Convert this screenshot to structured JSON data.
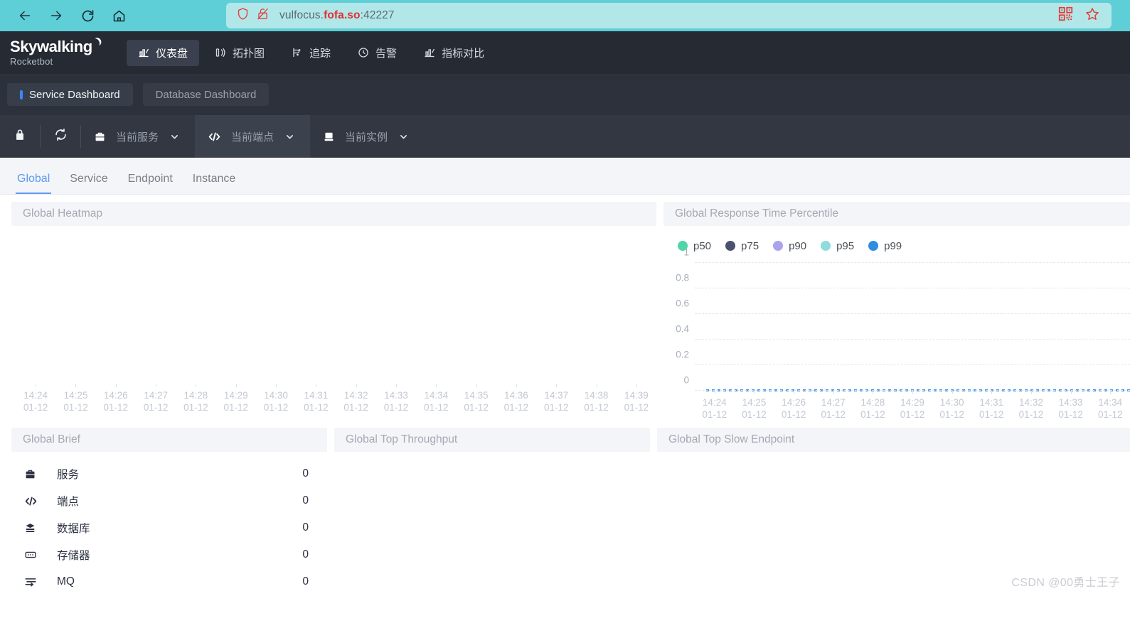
{
  "browser": {
    "back_icon": "back-arrow-icon",
    "forward_icon": "forward-arrow-icon",
    "reload_icon": "reload-icon",
    "home_icon": "home-icon",
    "shield_icon": "shield-icon",
    "insecure_icon": "broken-lock-icon",
    "url_prefix": "vulfocus.",
    "url_domain": "fofa.so",
    "url_suffix": ":42227",
    "qr_icon": "qr-code-icon",
    "bookmark_icon": "star-icon",
    "bar_color": "#5ecfd6",
    "url_field_color": "#b2e7e9"
  },
  "header": {
    "logo_main": "Skywalking",
    "logo_sub": "Rocketbot",
    "nav": [
      {
        "label": "仪表盘",
        "icon": "chart-icon",
        "active": true
      },
      {
        "label": "拓扑图",
        "icon": "topology-icon",
        "active": false
      },
      {
        "label": "追踪",
        "icon": "trace-icon",
        "active": false
      },
      {
        "label": "告警",
        "icon": "alarm-clock-icon",
        "active": false
      },
      {
        "label": "指标对比",
        "icon": "compare-chart-icon",
        "active": false
      }
    ]
  },
  "dashboard_tabs": [
    {
      "label": "Service Dashboard",
      "active": true
    },
    {
      "label": "Database Dashboard",
      "active": false
    }
  ],
  "selector_bar": {
    "lock_icon": "lock-icon",
    "reload_icon": "sync-icon",
    "selectors": [
      {
        "icon": "briefcase-icon",
        "label": "当前服务",
        "caret": "chevron-down-icon",
        "highlighted": false
      },
      {
        "icon": "code-icon",
        "label": "当前端点",
        "caret": "chevron-down-icon",
        "highlighted": true
      },
      {
        "icon": "server-icon",
        "label": "当前实例",
        "caret": "chevron-down-icon",
        "highlighted": false
      }
    ]
  },
  "sub_tabs": [
    {
      "label": "Global",
      "active": true
    },
    {
      "label": "Service",
      "active": false
    },
    {
      "label": "Endpoint",
      "active": false
    },
    {
      "label": "Instance",
      "active": false
    }
  ],
  "panels": {
    "heatmap_title": "Global Heatmap",
    "percentile_title": "Global Response Time Percentile",
    "brief_title": "Global Brief",
    "throughput_title": "Global Top Throughput",
    "slow_endpoint_title": "Global Top Slow Endpoint"
  },
  "brief_items": [
    {
      "icon": "briefcase-icon",
      "label": "服务",
      "value": "0"
    },
    {
      "icon": "code-icon",
      "label": "端点",
      "value": "0"
    },
    {
      "icon": "database-icon",
      "label": "数据库",
      "value": "0"
    },
    {
      "icon": "cache-icon",
      "label": "存储器",
      "value": "0"
    },
    {
      "icon": "mq-icon",
      "label": "MQ",
      "value": "0"
    }
  ],
  "watermark": "CSDN @00勇士王子",
  "chart_data": [
    {
      "type": "heatmap",
      "title": "Global Heatmap",
      "xlabel": "",
      "ylabel": "",
      "grid": false,
      "legend": "none",
      "x": [
        "14:24\n01-12",
        "14:25\n01-12",
        "14:26\n01-12",
        "14:27\n01-12",
        "14:28\n01-12",
        "14:29\n01-12",
        "14:30\n01-12",
        "14:31\n01-12",
        "14:32\n01-12",
        "14:33\n01-12",
        "14:34\n01-12",
        "14:35\n01-12",
        "14:36\n01-12",
        "14:37\n01-12",
        "14:38\n01-12",
        "14:39\n01-12"
      ],
      "xtick_times": [
        "14:24",
        "14:25",
        "14:26",
        "14:27",
        "14:28",
        "14:29",
        "14:30",
        "14:31",
        "14:32",
        "14:33",
        "14:34",
        "14:35",
        "14:36",
        "14:37",
        "14:38",
        "14:39"
      ],
      "xtick_dates": [
        "01-12",
        "01-12",
        "01-12",
        "01-12",
        "01-12",
        "01-12",
        "01-12",
        "01-12",
        "01-12",
        "01-12",
        "01-12",
        "01-12",
        "01-12",
        "01-12",
        "01-12",
        "01-12"
      ],
      "values": [],
      "note": "no data rendered in plot area"
    },
    {
      "type": "line",
      "title": "Global Response Time Percentile",
      "xlabel": "",
      "ylabel": "",
      "ylim": [
        0,
        1
      ],
      "yticks": [
        "0",
        "0.2",
        "0.4",
        "0.6",
        "0.8",
        "1"
      ],
      "grid": true,
      "legend_position": "top-left",
      "xtick_times": [
        "14:24",
        "14:25",
        "14:26",
        "14:27",
        "14:28",
        "14:29",
        "14:30",
        "14:31",
        "14:32",
        "14:33",
        "14:34"
      ],
      "xtick_dates": [
        "01-12",
        "01-12",
        "01-12",
        "01-12",
        "01-12",
        "01-12",
        "01-12",
        "01-12",
        "01-12",
        "01-12",
        "01-12"
      ],
      "series": [
        {
          "name": "p50",
          "color": "#4fd6a8",
          "values": [
            0,
            0,
            0,
            0,
            0,
            0,
            0,
            0,
            0,
            0,
            0
          ]
        },
        {
          "name": "p75",
          "color": "#4a5270",
          "values": [
            0,
            0,
            0,
            0,
            0,
            0,
            0,
            0,
            0,
            0,
            0
          ]
        },
        {
          "name": "p90",
          "color": "#a9a4ed",
          "values": [
            0,
            0,
            0,
            0,
            0,
            0,
            0,
            0,
            0,
            0,
            0
          ]
        },
        {
          "name": "p95",
          "color": "#8fdbdd",
          "values": [
            0,
            0,
            0,
            0,
            0,
            0,
            0,
            0,
            0,
            0,
            0
          ]
        },
        {
          "name": "p99",
          "color": "#2f8ce0",
          "values": [
            0,
            0,
            0,
            0,
            0,
            0,
            0,
            0,
            0,
            0,
            0
          ]
        }
      ]
    },
    {
      "type": "table",
      "title": "Global Brief",
      "columns": [
        "metric",
        "value"
      ],
      "rows": [
        [
          "服务",
          "0"
        ],
        [
          "端点",
          "0"
        ],
        [
          "数据库",
          "0"
        ],
        [
          "存储器",
          "0"
        ],
        [
          "MQ",
          "0"
        ]
      ]
    },
    {
      "type": "bar",
      "title": "Global Top Throughput",
      "categories": [],
      "values": [],
      "note": "empty panel"
    },
    {
      "type": "bar",
      "title": "Global Top Slow Endpoint",
      "categories": [],
      "values": [],
      "note": "empty panel"
    }
  ]
}
